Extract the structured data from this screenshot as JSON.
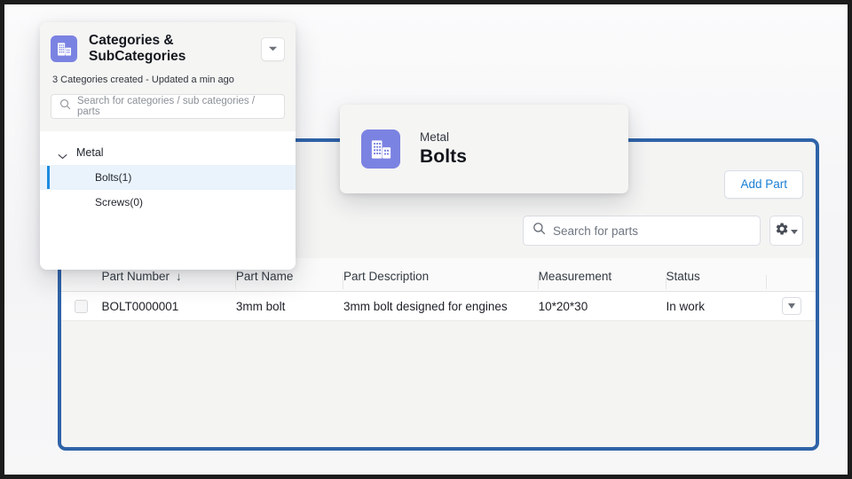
{
  "theme": {
    "accent_blue": "#1b7fd4",
    "panel_border_blue": "#2f63a8",
    "icon_purple": "#7b83e2",
    "selected_row_bg": "#eaf3fc",
    "selected_bar": "#1b8ae0",
    "page_bg": "#f7f7f8",
    "card_bg": "#f5f5f4"
  },
  "categories_panel": {
    "icon": "building-icon",
    "title": "Categories & SubCategories",
    "collapse_icon": "chevron-down-icon",
    "meta": "3 Categories created - Updated a min ago",
    "search": {
      "icon": "search-icon",
      "placeholder": "Search for categories / sub categories / parts",
      "value": ""
    },
    "tree": {
      "root": {
        "label": "Metal",
        "expand_icon": "chevron-down-icon",
        "expanded": true
      },
      "items": [
        {
          "label": "Bolts(1)",
          "selected": true
        },
        {
          "label": "Screws(0)",
          "selected": false
        }
      ]
    }
  },
  "detail_card": {
    "icon": "building-icon",
    "parent": "Metal",
    "title": "Bolts"
  },
  "main_panel": {
    "add_part_button": "Add Part",
    "search": {
      "icon": "search-icon",
      "placeholder": "Search for parts",
      "value": ""
    },
    "settings_button": {
      "icon": "gear-icon",
      "caret_icon": "caret-down-icon"
    },
    "table": {
      "columns": [
        {
          "label": "Part Number",
          "sort_icon": "arrow-down-icon",
          "sorted": true
        },
        {
          "label": "Part Name",
          "sort_icon": "",
          "sorted": false
        },
        {
          "label": "Part Description",
          "sort_icon": "",
          "sorted": false
        },
        {
          "label": "Measurement",
          "sort_icon": "",
          "sorted": false
        },
        {
          "label": "Status",
          "sort_icon": "",
          "sorted": false
        }
      ],
      "rows": [
        {
          "checkbox": false,
          "part_number": "BOLT0000001",
          "part_name": "3mm bolt",
          "part_description": "3mm bolt designed for engines",
          "measurement": "10*20*30",
          "status": "In work",
          "row_menu_icon": "caret-down-icon"
        }
      ]
    }
  }
}
